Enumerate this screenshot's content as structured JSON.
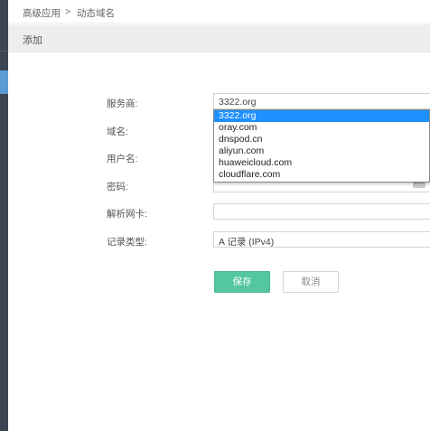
{
  "breadcrumb": {
    "item1": "高级应用",
    "separator": ">",
    "item2": "动态域名"
  },
  "page_title": "添加",
  "form": {
    "provider_label": "服务商:",
    "provider_value": "3322.org",
    "provider_options": [
      "3322.org",
      "oray.com",
      "dnspod.cn",
      "aliyun.com",
      "huaweicloud.com",
      "cloudflare.com"
    ],
    "domain_label": "域名:",
    "username_label": "用户名:",
    "password_label": "密码:",
    "nic_label": "解析网卡:",
    "nic_value": "",
    "record_type_label": "记录类型:",
    "record_type_value": "A 记录 (IPv4)"
  },
  "buttons": {
    "save": "保存",
    "cancel": "取消"
  },
  "colors": {
    "save_bg": "#54c79e",
    "selected_option": "#1e90ff",
    "sidebar_bg": "#3b4452"
  },
  "icons": {
    "password_toggle": "password-keyboard-icon"
  }
}
